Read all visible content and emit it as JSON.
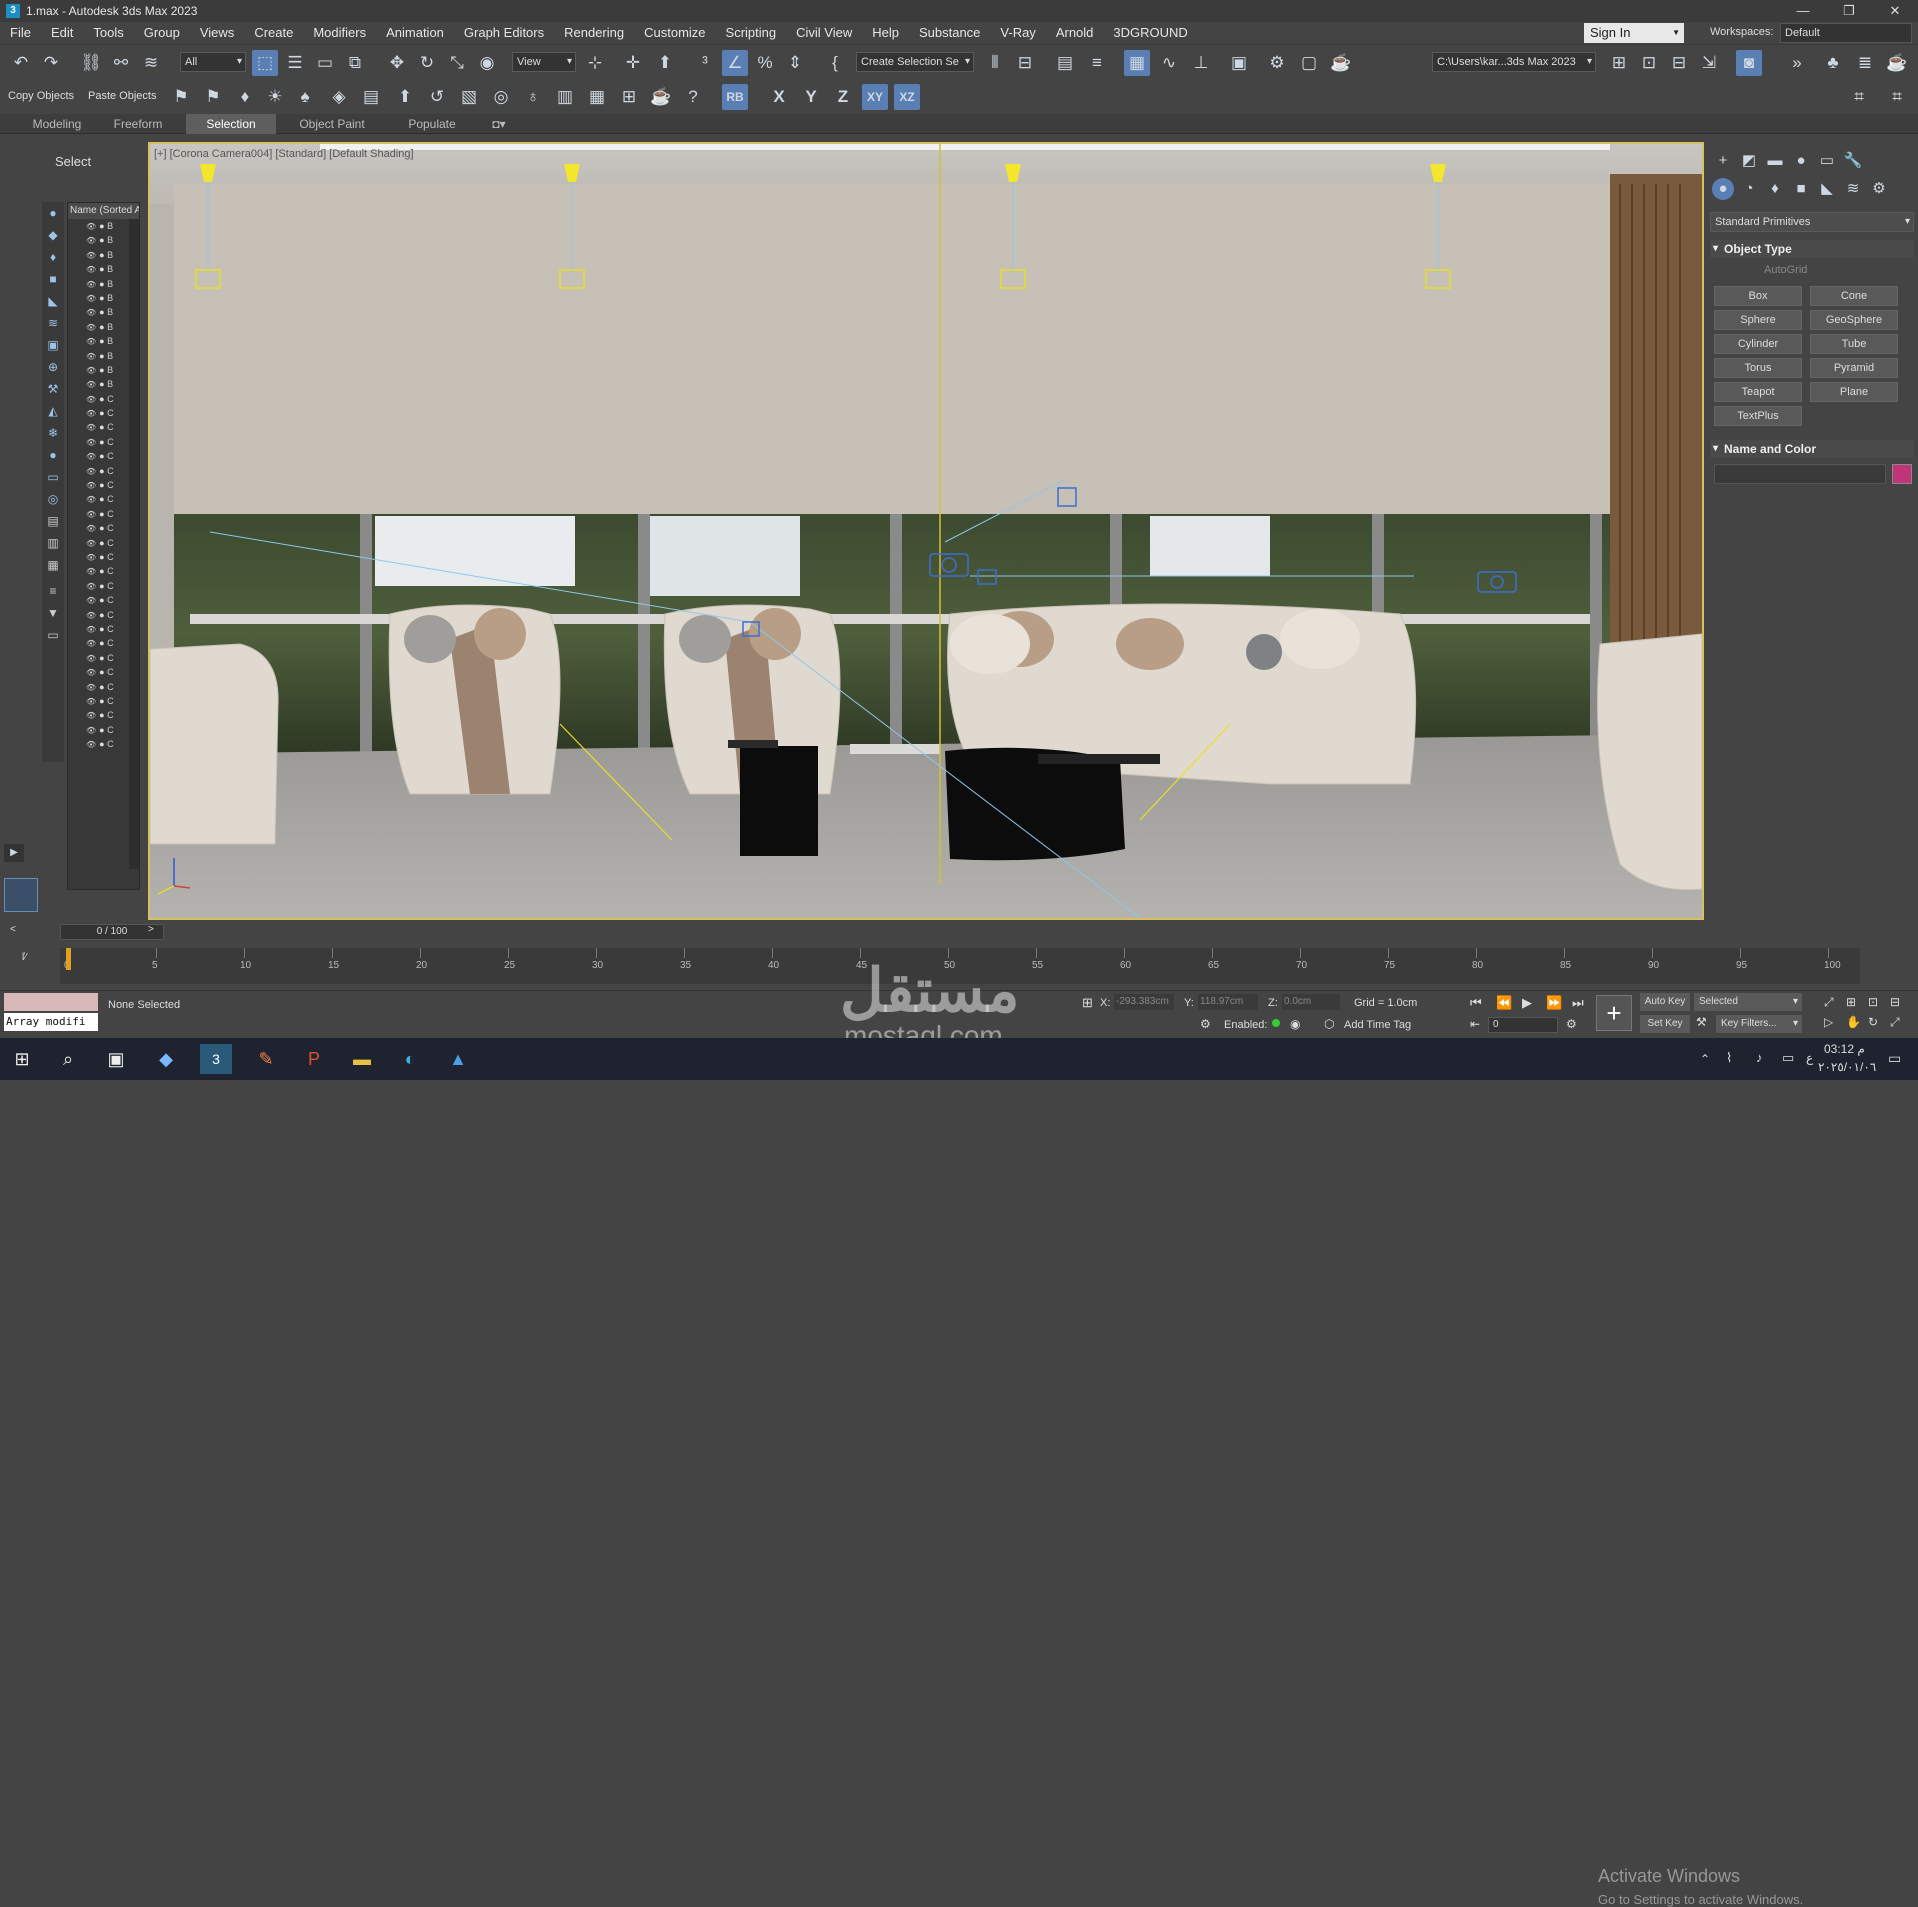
{
  "window": {
    "title": "1.max - Autodesk 3ds Max 2023",
    "app_icon": "3",
    "controls": [
      "—",
      "❐",
      "✕"
    ]
  },
  "menu": [
    "File",
    "Edit",
    "Tools",
    "Group",
    "Views",
    "Create",
    "Modifiers",
    "Animation",
    "Graph Editors",
    "Rendering",
    "Customize",
    "Scripting",
    "Civil View",
    "Help",
    "Substance",
    "V-Ray",
    "Arnold",
    "3DGROUND"
  ],
  "signin": "Sign In",
  "workspaces": {
    "label": "Workspaces:",
    "value": "Default"
  },
  "toolbar": {
    "filter": "All",
    "refcoord": "View",
    "selection_set": "Create Selection Se",
    "project_path": "C:\\Users\\kar...3ds Max 2023",
    "copy_objects": "Copy Objects",
    "paste_objects": "Paste Objects",
    "axis_rb": "RB",
    "axis_x": "X",
    "axis_y": "Y",
    "axis_z": "Z",
    "axis_xy": "XY",
    "axis_xz": "XZ"
  },
  "ribbon_tabs": [
    "Modeling",
    "Freeform",
    "Selection",
    "Object Paint",
    "Populate"
  ],
  "left": {
    "select_label": "Select",
    "scene_header": "Name (Sorted A",
    "rows": [
      "B",
      "B",
      "B",
      "B",
      "B",
      "B",
      "B",
      "B",
      "B",
      "B",
      "B",
      "B",
      "C",
      "C",
      "C",
      "C",
      "C",
      "C",
      "C",
      "C",
      "C",
      "C",
      "C",
      "C",
      "C",
      "C",
      "C",
      "C",
      "C",
      "C",
      "C",
      "C",
      "C",
      "C",
      "C",
      "C",
      "C"
    ]
  },
  "viewport": {
    "label": "[+] [Corona Camera004] [Standard] [Default Shading]"
  },
  "command_panel": {
    "dropdown": "Standard Primitives",
    "object_type_title": "Object Type",
    "autogrid": "AutoGrid",
    "buttons": [
      "Box",
      "Cone",
      "Sphere",
      "GeoSphere",
      "Cylinder",
      "Tube",
      "Torus",
      "Pyramid",
      "Teapot",
      "Plane",
      "TextPlus"
    ],
    "name_color_title": "Name and Color",
    "color_swatch": "#c0357a"
  },
  "timeline": {
    "frame_slider": "0 / 100",
    "ticks": [
      "0",
      "5",
      "10",
      "15",
      "20",
      "25",
      "30",
      "35",
      "40",
      "45",
      "50",
      "55",
      "60",
      "65",
      "70",
      "75",
      "80",
      "85",
      "90",
      "95",
      "100"
    ]
  },
  "status": {
    "none_selected": "None Selected",
    "maxscript": "Array modifi",
    "x_label": "X:",
    "x_value": "-293.383cm",
    "y_label": "Y:",
    "y_value": "118.97cm",
    "z_label": "Z:",
    "z_value": "0.0cm",
    "grid": "Grid = 1.0cm",
    "enabled": "Enabled:",
    "add_time_tag": "Add Time Tag",
    "auto_key": "Auto Key",
    "set_key": "Set Key",
    "selected": "Selected",
    "key_filters": "Key Filters...",
    "frame": "0"
  },
  "watermark": {
    "activate": "Activate Windows",
    "goto": "Go to Settings to activate Windows.",
    "mostaql": "مستقل",
    "mostaql_url": "mostaql.com"
  },
  "taskbar": {
    "time": "03:12 م",
    "date": "٢٠٢٥/٠١/٠٦",
    "lang": "ع"
  }
}
